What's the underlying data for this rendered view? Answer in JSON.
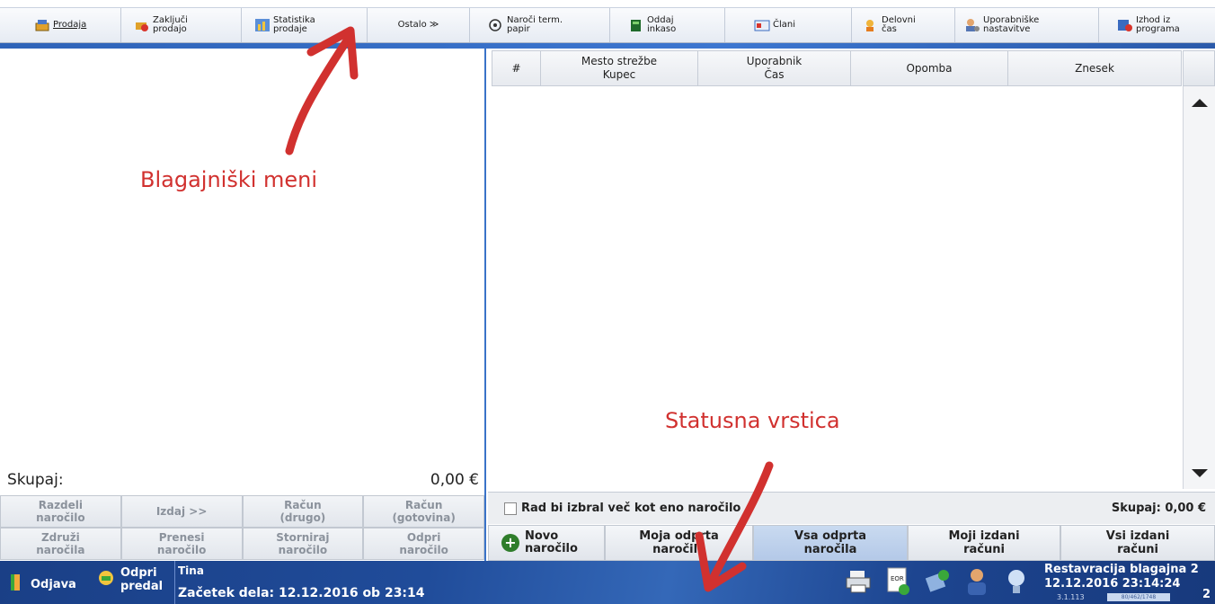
{
  "menu": {
    "items": [
      {
        "label1": "Prodaja",
        "label2": ""
      },
      {
        "label1": "Zaključi",
        "label2": "prodajo"
      },
      {
        "label1": "Statistika",
        "label2": "prodaje"
      },
      {
        "label1": "Ostalo ≫",
        "label2": ""
      },
      {
        "label1": "Naroči term.",
        "label2": "papir"
      },
      {
        "label1": "Oddaj",
        "label2": "inkaso"
      },
      {
        "label1": "Člani",
        "label2": ""
      },
      {
        "label1": "Delovni",
        "label2": "čas"
      },
      {
        "label1": "Uporabniške",
        "label2": "nastavitve"
      },
      {
        "label1": "Izhod iz",
        "label2": "programa"
      }
    ]
  },
  "left": {
    "skupaj_label": "Skupaj:",
    "skupaj_value": "0,00 €",
    "actions": [
      {
        "l1": "Razdeli",
        "l2": "naročilo"
      },
      {
        "l1": "Izdaj >>",
        "l2": ""
      },
      {
        "l1": "Račun",
        "l2": "(drugo)"
      },
      {
        "l1": "Račun",
        "l2": "(gotovina)"
      },
      {
        "l1": "Združi",
        "l2": "naročila"
      },
      {
        "l1": "Prenesi",
        "l2": "naročilo"
      },
      {
        "l1": "Storniraj",
        "l2": "naročilo"
      },
      {
        "l1": "Odpri",
        "l2": "naročilo"
      }
    ]
  },
  "table": {
    "columns": [
      {
        "l1": "#",
        "l2": ""
      },
      {
        "l1": "Mesto strežbe",
        "l2": "Kupec"
      },
      {
        "l1": "Uporabnik",
        "l2": "Čas"
      },
      {
        "l1": "Opomba",
        "l2": ""
      },
      {
        "l1": "Znesek",
        "l2": ""
      }
    ]
  },
  "orders": {
    "multi_select_label": "Rad bi izbral več kot eno naročilo",
    "total": "Skupaj: 0,00 €",
    "tabs": [
      {
        "l1": "Novo",
        "l2": "naročilo"
      },
      {
        "l1": "Moja odprta",
        "l2": "naročila"
      },
      {
        "l1": "Vsa odprta",
        "l2": "naročila"
      },
      {
        "l1": "Moji izdani",
        "l2": "računi"
      },
      {
        "l1": "Vsi izdani",
        "l2": "računi"
      }
    ]
  },
  "status": {
    "logout": "Odjava",
    "open_drawer1": "Odpri",
    "open_drawer2": "predal",
    "user": "Tina",
    "shift_start": "Začetek dela: 12.12.2016 ob 23:14",
    "station": "Restavracija blagajna 2",
    "datetime": "12.12.2016 23:14:24",
    "version": "3.1.113",
    "version_box": "80/462/1748",
    "corner": "2"
  },
  "annotations": {
    "menu_label": "Blagajniški meni",
    "status_label": "Statusna vrstica",
    "color": "#d1312f"
  }
}
